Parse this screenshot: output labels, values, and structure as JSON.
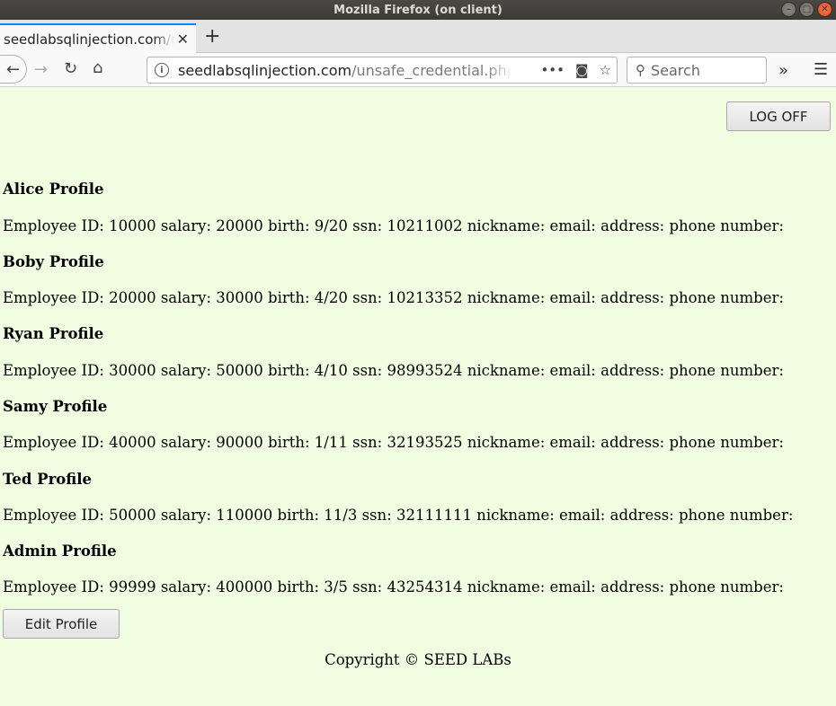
{
  "window": {
    "title": "Mozilla Firefox (on client)"
  },
  "tab": {
    "title": "seedlabsqlinjection.com/unsafe_credential.php"
  },
  "url": {
    "host": "seedlabsqlinjection.com",
    "path": "/unsafe_credential.php?E"
  },
  "search": {
    "placeholder": "Search"
  },
  "logoff_label": "LOG OFF",
  "profiles": [
    {
      "name": "Alice Profile",
      "info": "Employee ID: 10000 salary: 20000 birth: 9/20 ssn: 10211002 nickname: email: address: phone number:"
    },
    {
      "name": "Boby Profile",
      "info": "Employee ID: 20000 salary: 30000 birth: 4/20 ssn: 10213352 nickname: email: address: phone number:"
    },
    {
      "name": "Ryan Profile",
      "info": "Employee ID: 30000 salary: 50000 birth: 4/10 ssn: 98993524 nickname: email: address: phone number:"
    },
    {
      "name": "Samy Profile",
      "info": "Employee ID: 40000 salary: 90000 birth: 1/11 ssn: 32193525 nickname: email: address: phone number:"
    },
    {
      "name": "Ted Profile",
      "info": "Employee ID: 50000 salary: 110000 birth: 11/3 ssn: 32111111 nickname: email: address: phone number:"
    },
    {
      "name": "Admin Profile",
      "info": "Employee ID: 99999 salary: 400000 birth: 3/5 ssn: 43254314 nickname: email: address: phone number:"
    }
  ],
  "edit_profile_label": "Edit Profile",
  "copyright": "Copyright © SEED LABs",
  "colors": {
    "page_bg": "#f0fde0",
    "tab_accent": "#0a84ff"
  }
}
